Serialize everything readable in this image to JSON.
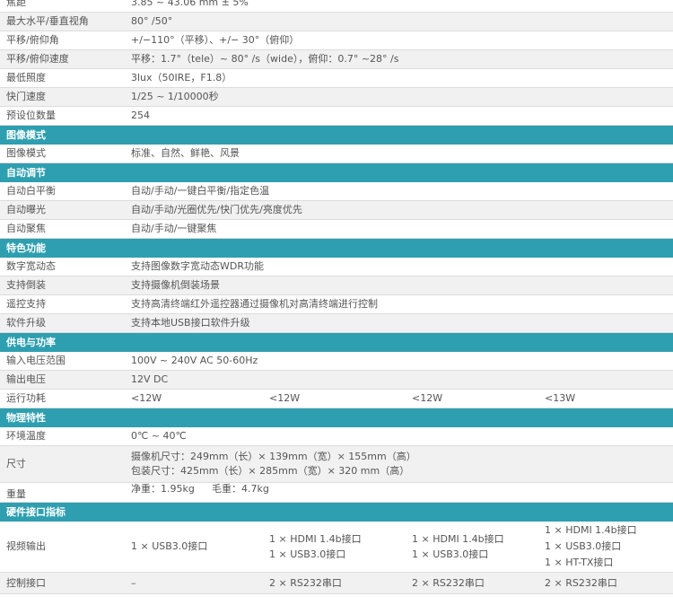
{
  "rows_top": [
    {
      "label": "焦距",
      "value": "3.85 ~ 43.06 mm ± 5%"
    },
    {
      "label": "最大水平/垂直视角",
      "value": "80° /50°"
    },
    {
      "label": "平移/俯仰角",
      "value": "+/−110°（平移）、+/− 30°（俯仰）"
    },
    {
      "label": "平移/俯仰速度",
      "value": "平移：1.7°（tele）~ 80° /s（wide），俯仰：0.7° ~28° /s"
    },
    {
      "label": "最低照度",
      "value": "3lux（50IRE，F1.8）"
    },
    {
      "label": "快门速度",
      "value": "1/25 ~ 1/10000秒"
    },
    {
      "label": "预设位数量",
      "value": "254"
    }
  ],
  "sections": {
    "image": "图像模式",
    "auto": "自动调节",
    "feature": "特色功能",
    "power": "供电与功率",
    "physical": "物理特性",
    "hardware": "硬件接口指标"
  },
  "image_rows": [
    {
      "label": "图像模式",
      "value": "标准、自然、鲜艳、风景"
    }
  ],
  "auto_rows": [
    {
      "label": "自动白平衡",
      "value": "自动/手动/一键白平衡/指定色温"
    },
    {
      "label": "自动曝光",
      "value": "自动/手动/光圈优先/快门优先/亮度优先"
    },
    {
      "label": "自动聚焦",
      "value": "自动/手动/一键聚焦"
    }
  ],
  "feature_rows": [
    {
      "label": "数字宽动态",
      "value": "支持图像数字宽动态WDR功能"
    },
    {
      "label": "支持倒装",
      "value": "支持摄像机倒装场景"
    },
    {
      "label": "遥控支持",
      "value": "支持高清终端红外遥控器通过摄像机对高清终端进行控制"
    },
    {
      "label": "软件升级",
      "value": "支持本地USB接口软件升级"
    }
  ],
  "power_rows": [
    {
      "label": "输入电压范围",
      "value": "100V ~ 240V AC 50-60Hz"
    },
    {
      "label": "输出电压",
      "value": "12V DC"
    }
  ],
  "power_consumption": {
    "label": "运行功耗",
    "values": [
      "<12W",
      "<12W",
      "<12W",
      "<13W"
    ]
  },
  "physical": {
    "temp_label": "环境温度",
    "temp_value": "0℃ ~ 40℃",
    "size_label": "尺寸",
    "size_line1": "摄像机尺寸：249mm（长）× 139mm（宽）× 155mm（高）",
    "size_line2": "包装尺寸：425mm（长）× 285mm（宽）× 320 mm（高）",
    "weight_label": "重量",
    "weight_net": "净重：1.95kg",
    "weight_gross": "毛重：4.7kg"
  },
  "hardware": {
    "video_label": "视频输出",
    "video_col1": [
      "1 × USB3.0接口"
    ],
    "video_col2": [
      "1 × HDMI 1.4b接口",
      "1 × USB3.0接口"
    ],
    "video_col3": [
      "1 × HDMI 1.4b接口",
      "1 × USB3.0接口"
    ],
    "video_col4": [
      "1 × HDMI 1.4b接口",
      "1 × USB3.0接口",
      "1 × HT-TX接口"
    ],
    "control_label": "控制接口",
    "control_values": [
      "–",
      "2 × RS232串口",
      "2 × RS232串口",
      "2 × RS232串口"
    ]
  },
  "colors": {
    "section_bg": "#2e9fb0",
    "alt_row": "#f1f1f1"
  }
}
